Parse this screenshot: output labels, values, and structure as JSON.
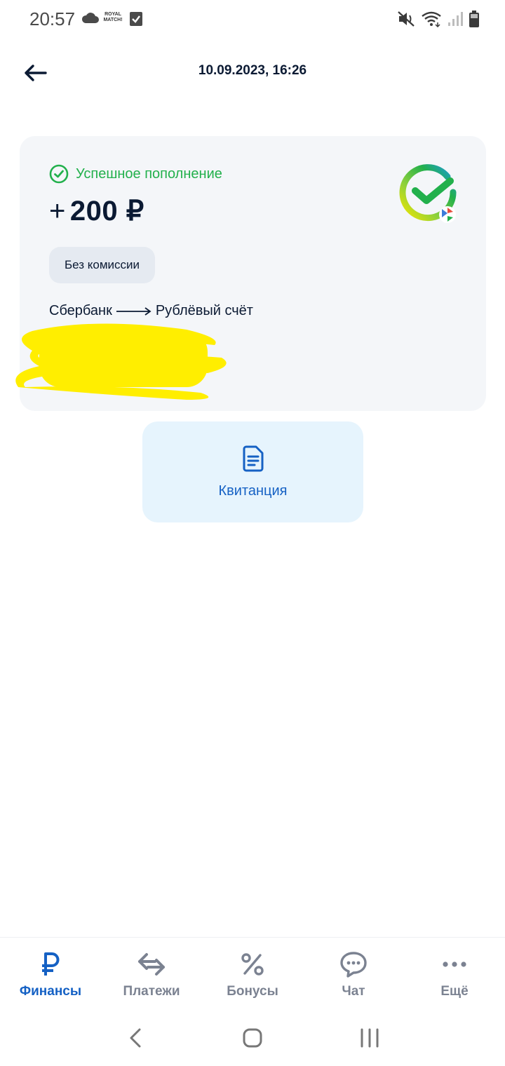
{
  "status_bar": {
    "time": "20:57",
    "app_badge": "ROYAL MATCH!",
    "icons": [
      "cloud-icon",
      "royal-match-icon",
      "checkbox-icon",
      "mute-icon",
      "wifi-icon",
      "signal-icon",
      "battery-icon"
    ]
  },
  "header": {
    "title": "10.09.2023, 16:26",
    "back_icon": "arrow-left-icon"
  },
  "transaction": {
    "status": "Успешное пополнение",
    "amount_sign": "+",
    "amount": "200 ₽",
    "fee": "Без комиссии",
    "from": "Сбербанк",
    "to": "Рублёвый счёт",
    "bank_logo": "sber-logo"
  },
  "receipt": {
    "label": "Квитанция",
    "icon": "document-icon"
  },
  "bottom_nav": {
    "items": [
      {
        "label": "Финансы",
        "icon": "ruble-icon",
        "active": true
      },
      {
        "label": "Платежи",
        "icon": "transfer-icon",
        "active": false
      },
      {
        "label": "Бонусы",
        "icon": "percent-icon",
        "active": false
      },
      {
        "label": "Чат",
        "icon": "chat-icon",
        "active": false
      },
      {
        "label": "Ещё",
        "icon": "more-icon",
        "active": false
      }
    ]
  },
  "colors": {
    "accent": "#1561c4",
    "success": "#22b04c",
    "card_bg": "#f4f6f9",
    "receipt_bg": "#e6f4fd",
    "redaction": "#ffee00"
  }
}
